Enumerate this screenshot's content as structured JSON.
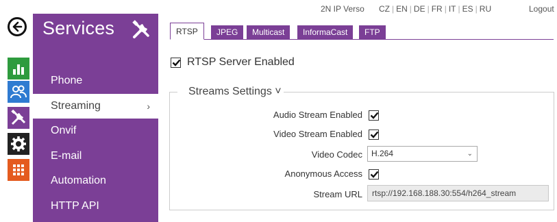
{
  "header": {
    "device_name": "2N IP Verso",
    "languages": [
      "CZ",
      "EN",
      "DE",
      "FR",
      "IT",
      "ES",
      "RU"
    ],
    "logout_label": "Logout"
  },
  "rail": {
    "icons": [
      "back-arrow-icon",
      "status-chart-icon",
      "users-icon",
      "services-tools-icon",
      "settings-gear-icon",
      "system-grid-icon"
    ],
    "colors": {
      "green": "#2e9b3e",
      "blue": "#2f7bd1",
      "purple": "#7b3f96",
      "dark": "#222222",
      "orange": "#e45b1f"
    }
  },
  "sidebar": {
    "title": "Services",
    "icon": "tools-icon",
    "items": [
      {
        "label": "Phone"
      },
      {
        "label": "Streaming",
        "active": true,
        "chevron": "›"
      },
      {
        "label": "Onvif"
      },
      {
        "label": "E-mail"
      },
      {
        "label": "Automation"
      },
      {
        "label": "HTTP API"
      }
    ]
  },
  "tabs": [
    {
      "label": "RTSP",
      "active": true
    },
    {
      "label": "JPEG"
    },
    {
      "label": "Multicast"
    },
    {
      "label": "InformaCast"
    },
    {
      "label": "FTP"
    }
  ],
  "main": {
    "server_enabled": {
      "label": "RTSP Server Enabled",
      "checked": true
    },
    "streams": {
      "legend": "Streams Settings ˅",
      "audio": {
        "label": "Audio Stream Enabled",
        "checked": true
      },
      "video": {
        "label": "Video Stream Enabled",
        "checked": true
      },
      "codec": {
        "label": "Video Codec",
        "value": "H.264"
      },
      "anonymous": {
        "label": "Anonymous Access",
        "checked": true
      },
      "url": {
        "label": "Stream URL",
        "value": "rtsp://192.168.188.30:554/h264_stream"
      }
    }
  }
}
